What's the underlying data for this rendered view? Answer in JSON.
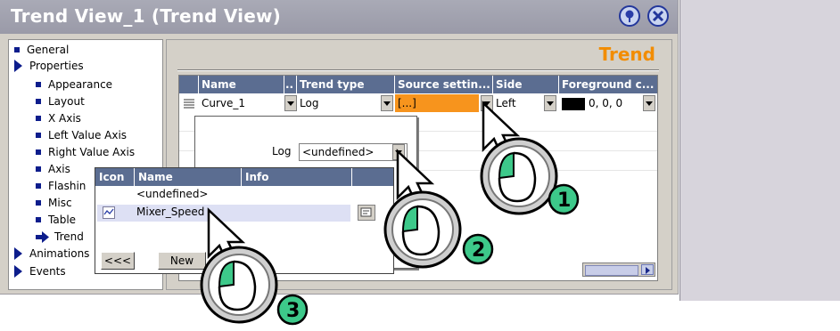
{
  "window": {
    "title": "Trend View_1 (Trend View)",
    "help_icon": "help-pin-icon",
    "close_icon": "close-icon"
  },
  "tree": {
    "items": [
      {
        "label": "General",
        "marker": "square"
      },
      {
        "label": "Properties",
        "marker": "triangle"
      },
      {
        "label": "Appearance",
        "marker": "square"
      },
      {
        "label": "Layout",
        "marker": "square"
      },
      {
        "label": "X Axis",
        "marker": "square"
      },
      {
        "label": "Left Value Axis",
        "marker": "square"
      },
      {
        "label": "Right Value Axis",
        "marker": "square"
      },
      {
        "label": "Axis",
        "marker": "square"
      },
      {
        "label": "Flashin",
        "marker": "square"
      },
      {
        "label": "Misc",
        "marker": "square"
      },
      {
        "label": "Table",
        "marker": "square"
      },
      {
        "label": "Trend",
        "marker": "arrow"
      },
      {
        "label": "Animations",
        "marker": "triangle"
      },
      {
        "label": "Events",
        "marker": "triangle"
      }
    ]
  },
  "section": {
    "title": "Trend"
  },
  "grid": {
    "headers": [
      "Name",
      "..",
      "Trend type",
      "Source settin...",
      "Side",
      "Foreground c..."
    ],
    "row": {
      "name": "Curve_1",
      "trend_type": "Log",
      "source_settings": "[...]",
      "side": "Left",
      "foreground": "0, 0, 0"
    },
    "source_color": "#f7941d"
  },
  "log_popup": {
    "label": "Log",
    "value": "<undefined>"
  },
  "icon_popup": {
    "headers": [
      "Icon",
      "Name",
      "Info"
    ],
    "rows": [
      {
        "name": "<undefined>",
        "info": ""
      },
      {
        "name": "Mixer_Speed",
        "info": ""
      }
    ],
    "back_label": "<<<",
    "new_label": "New"
  },
  "steps": [
    "1",
    "2",
    "3"
  ],
  "colors": {
    "header_bg": "#5b6d91",
    "accent": "#f28c00",
    "step_fill": "#3dc98a"
  }
}
